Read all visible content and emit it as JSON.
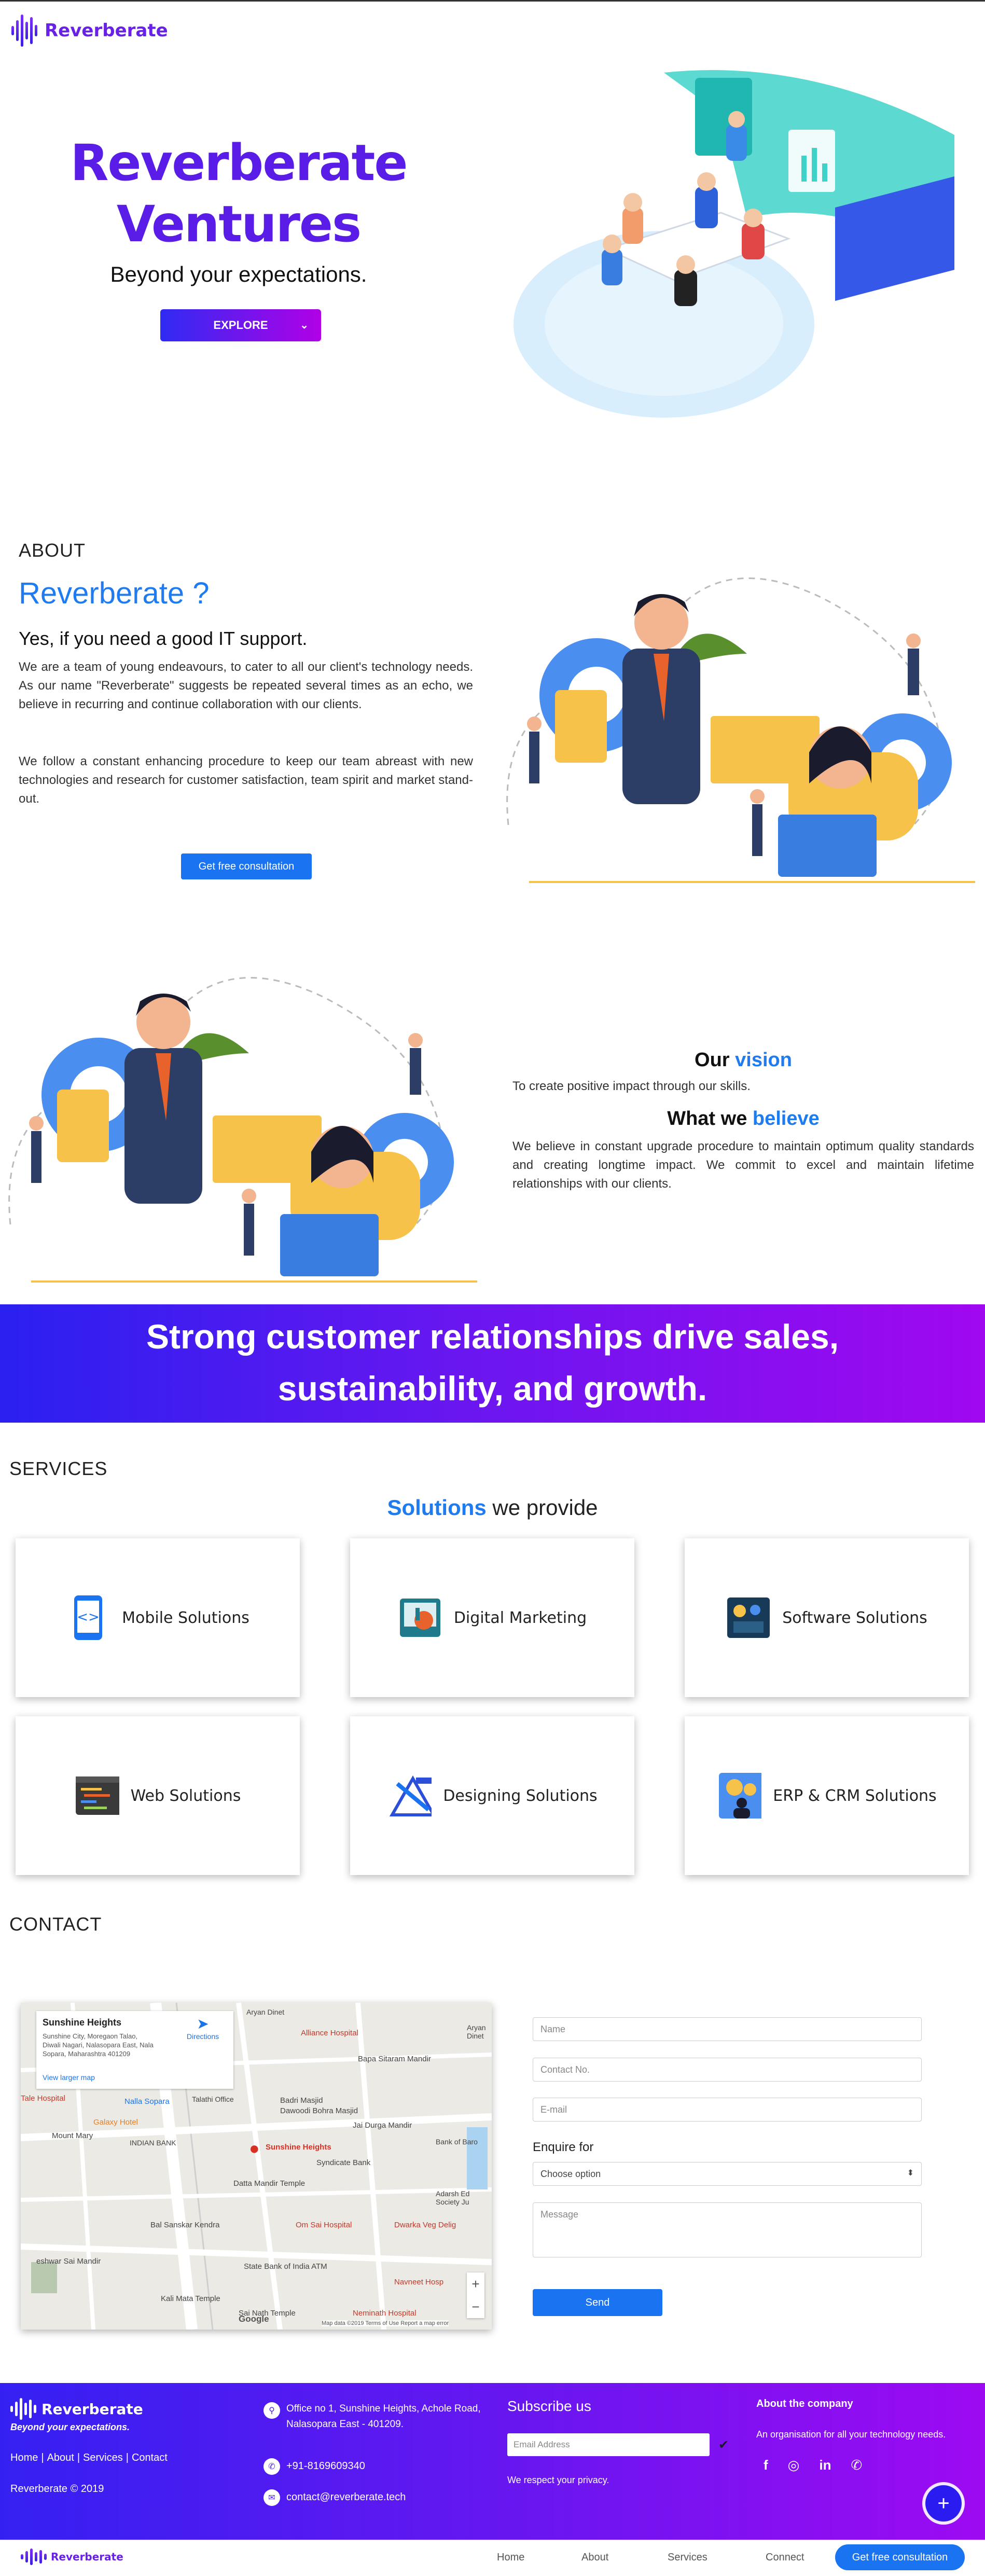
{
  "brand": {
    "name": "Reverberate"
  },
  "hero": {
    "title_line1": "Reverberate",
    "title_line2": "Ventures",
    "subtitle": "Beyond your expectations.",
    "explore_label": "EXPLORE"
  },
  "about": {
    "label": "ABOUT",
    "heading": "Reverberate ?",
    "subheading": "Yes, if you need a good IT support.",
    "para1": "We are a team of young endeavours, to cater to all our client's technology needs. As our name \"Reverberate\" suggests be repeated several times as an echo, we believe in recurring and continue collaboration with our clients.",
    "para2": "We follow a constant enhancing procedure to keep our team abreast with new technologies and research for customer satisfaction, team spirit and market stand-out.",
    "cta_label": "Get free consultation"
  },
  "vision": {
    "title_prefix": "Our ",
    "title_highlight": "vision",
    "text": "To create positive impact through our skills.",
    "believe_prefix": "What we ",
    "believe_highlight": "believe",
    "believe_text": "We believe in constant upgrade procedure to maintain optimum quality standards and creating longtime impact. We commit to excel and maintain lifetime relationships with our clients."
  },
  "banner": {
    "line1": "Strong customer relationships drive sales,",
    "line2": "sustainability, and growth."
  },
  "services": {
    "label": "SERVICES",
    "heading_highlight": "Solutions",
    "heading_rest": " we provide",
    "cards": [
      {
        "label": "Mobile Solutions",
        "icon": "mobile-code-icon"
      },
      {
        "label": "Digital Marketing",
        "icon": "digital-marketing-icon"
      },
      {
        "label": "Software Solutions",
        "icon": "software-icon"
      },
      {
        "label": "Web Solutions",
        "icon": "web-code-icon"
      },
      {
        "label": "Designing Solutions",
        "icon": "design-tools-icon"
      },
      {
        "label": "ERP & CRM Solutions",
        "icon": "erp-crm-icon"
      }
    ]
  },
  "contact": {
    "label": "CONTACT",
    "map": {
      "place_name": "Sunshine Heights",
      "address_line1": "Sunshine City, Moregaon Talao,",
      "address_line2": "Diwali Nagari, Nalasopara East, Nala",
      "address_line3": "Sopara, Maharashtra 401209",
      "view_larger": "View larger map",
      "directions": "Directions",
      "marker_label": "Sunshine Heights",
      "labels": [
        "Alliance Hospital",
        "Bapa Sitaram Mandir",
        "Galaxy Hotel",
        "Badri Masjid",
        "Dawoodi Bohra Masjid",
        "Jai Durga Mandir",
        "Talathi Office",
        "Nalla Sopara",
        "INDIAN BANK",
        "Mount Mary",
        "Syndicate Bank",
        "Datta Mandir Temple",
        "Bal Sanskar Kendra",
        "Om Sai Hospital",
        "Dwarka Veg Delig",
        "State Bank of India ATM",
        "Kali Mata Temple",
        "Navneet Hosp",
        "Neminath Hospital",
        "Sai Nath Temple",
        "Adarsh Ed Society Ju",
        "Bank of Baro",
        "eshwar Sai Mandir",
        "Tale Hospital",
        "Aryan Dinet"
      ],
      "footer_text": "Map data ©2019   Terms of Use   Report a map error",
      "zoom_in": "+",
      "zoom_out": "−",
      "google": "Google"
    },
    "form": {
      "name_placeholder": "Name",
      "contact_placeholder": "Contact No.",
      "email_placeholder": "E-mail",
      "enquire_label": "Enquire  for",
      "select_value": "Choose option",
      "message_placeholder": "Message",
      "send_label": "Send"
    }
  },
  "footer": {
    "tagline": "Beyond your expectations.",
    "links": [
      "Home",
      "About",
      "Services",
      "Contact"
    ],
    "copyright": "Reverberate © 2019",
    "address_line1": "Office no 1, Sunshine Heights, Achole Road,",
    "address_line2": "Nalasopara East - 401209.",
    "phone": "+91-8169609340",
    "email": "contact@reverberate.tech",
    "subscribe_title": "Subscribe us",
    "email_placeholder": "Email Address",
    "privacy": "We respect your privacy.",
    "about_title": "About the company",
    "about_text": "An organisation for all your technology needs.",
    "social": [
      "facebook-icon",
      "instagram-icon",
      "linkedin-icon",
      "whatsapp-icon"
    ]
  },
  "bottom_nav": {
    "items": [
      "Home",
      "About",
      "Services",
      "Connect"
    ],
    "cta_label": "Get free consultation"
  },
  "colors": {
    "brand_purple": "#5a1de8",
    "accent_blue": "#1a73f0",
    "gradient_start": "#2a20f0",
    "gradient_end": "#a008f0"
  }
}
